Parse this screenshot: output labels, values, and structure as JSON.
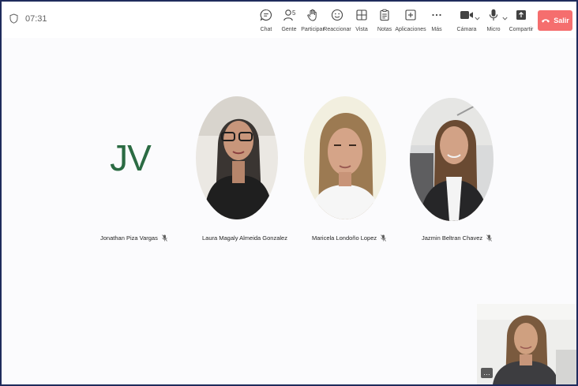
{
  "meeting": {
    "elapsed_time": "07:31"
  },
  "toolbar": {
    "chat": "Chat",
    "people": "Gente",
    "people_count": "5",
    "raise_hand": "Participar",
    "react": "Reaccionar",
    "view": "Vista",
    "notes": "Notas",
    "apps": "Aplicaciones",
    "more": "Más",
    "camera": "Cámara",
    "mic": "Micro",
    "share": "Compartir",
    "leave": "Salir"
  },
  "participants": [
    {
      "name": "Jonathan Piza Vargas",
      "initials": "JV",
      "muted": true
    },
    {
      "name": "Laura Magaly Almeida Gonzalez",
      "muted": false
    },
    {
      "name": "Maricela Londoño Lopez",
      "muted": true
    },
    {
      "name": "Jazmin Beltran Chavez",
      "muted": true
    }
  ],
  "self_view": {
    "more_label": "…"
  },
  "colors": {
    "leave_button": "#f56e6e",
    "initials": "#2b6b43",
    "frame_border": "#1f2b5c"
  },
  "icons": [
    "shield-icon",
    "chat-icon",
    "people-icon",
    "hand-icon",
    "react-icon",
    "view-icon",
    "notes-icon",
    "apps-icon",
    "more-icon",
    "camera-icon",
    "mic-icon",
    "share-icon",
    "phone-hangup-icon",
    "mic-muted-icon"
  ]
}
